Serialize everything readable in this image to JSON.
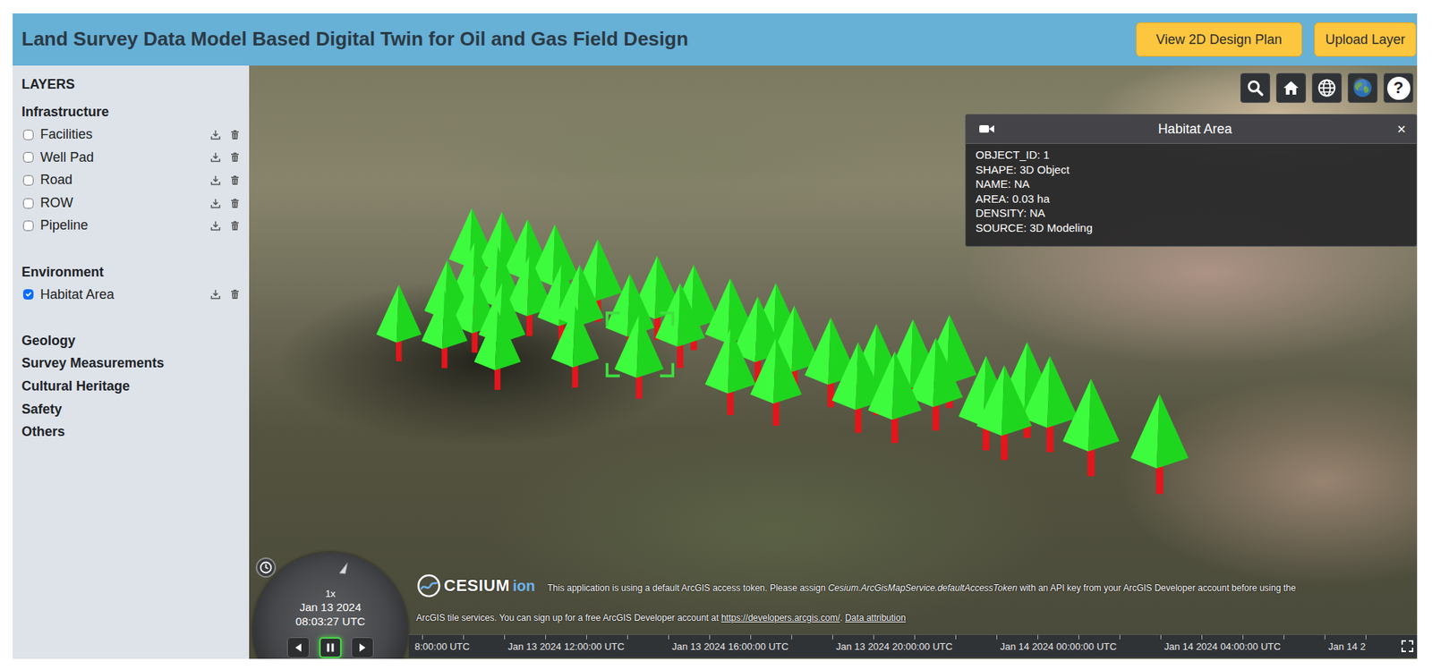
{
  "header": {
    "title": "Land Survey Data Model Based Digital Twin for Oil and Gas Field Design",
    "buttons": [
      "View 2D Design Plan",
      "Upload Layer"
    ]
  },
  "sidebar": {
    "title": "LAYERS",
    "groups": [
      {
        "label": "Infrastructure",
        "items": [
          {
            "label": "Facilities",
            "checked": false
          },
          {
            "label": "Well Pad",
            "checked": false
          },
          {
            "label": "Road",
            "checked": false
          },
          {
            "label": "ROW",
            "checked": false
          },
          {
            "label": "Pipeline",
            "checked": false
          }
        ]
      },
      {
        "label": "Environment",
        "items": [
          {
            "label": "Habitat Area",
            "checked": true
          }
        ]
      },
      {
        "label": "Geology",
        "items": []
      },
      {
        "label": "Survey Measurements",
        "items": []
      },
      {
        "label": "Cultural Heritage",
        "items": []
      },
      {
        "label": "Safety",
        "items": []
      },
      {
        "label": "Others",
        "items": []
      }
    ]
  },
  "toolbar": {
    "help": "?"
  },
  "info_panel": {
    "title": "Habitat Area",
    "close": "×",
    "rows": [
      "OBJECT_ID: 1",
      "SHAPE: 3D Object",
      "NAME: NA",
      "AREA: 0.03 ha",
      "DENSITY: NA",
      "SOURCE: 3D Modeling"
    ]
  },
  "clock": {
    "speed": "1x",
    "date": "Jan 13 2024",
    "time": "08:03:27 UTC",
    "playing": true
  },
  "attribution": {
    "logo": "CESIUM",
    "logo_suffix": "ion",
    "line1": [
      "This application is using a default ArcGIS access token. Please assign ",
      "Cesium.ArcGisMapService.defaultAccessToken",
      " with an API key from your ArcGIS Developer account before using the"
    ],
    "line2": [
      "ArcGIS tile services. You can sign up for a free ArcGIS Developer account at ",
      "https://developers.arcgis.com/",
      ". ",
      "Data attribution"
    ]
  },
  "timeline": {
    "labels": [
      "8:00:00 UTC",
      "Jan 13 2024 12:00:00 UTC",
      "Jan 13 2024 16:00:00 UTC",
      "Jan 13 2024 20:00:00 UTC",
      "Jan 14 2024 00:00:00 UTC",
      "Jan 14 2024 04:00:00 UTC",
      "Jan 14 2"
    ]
  }
}
